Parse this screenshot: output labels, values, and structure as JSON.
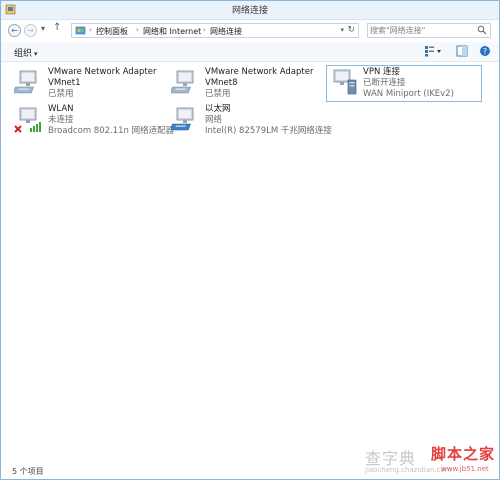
{
  "window": {
    "title": "网络连接"
  },
  "nav": {
    "back_glyph": "←",
    "forward_glyph": "→",
    "history_glyph": "▾",
    "up_glyph": "↑"
  },
  "address": {
    "crumbs": [
      "控制面板",
      "网络和 Internet",
      "网络连接"
    ],
    "separator": "›"
  },
  "search": {
    "placeholder": "搜索\"网络连接\""
  },
  "toolbar": {
    "organize_label": "组织",
    "organize_caret": "▾"
  },
  "connections": [
    {
      "name": "VMware Network Adapter",
      "line2": "VMnet1",
      "status": "已禁用",
      "icon": "network-adapter-icon"
    },
    {
      "name": "VMware Network Adapter",
      "line2": "VMnet8",
      "status": "已禁用",
      "icon": "network-adapter-icon"
    },
    {
      "name": "VPN 连接",
      "line2": "已断开连接",
      "status": "WAN Miniport (IKEv2)",
      "icon": "vpn-connection-icon"
    },
    {
      "name": "WLAN",
      "line2": "未连接",
      "status": "Broadcom 802.11n 网络适配器",
      "icon": "wireless-adapter-icon"
    },
    {
      "name": "以太网",
      "line2": "网络",
      "status": "Intel(R) 82579LM 千兆网络连接",
      "icon": "ethernet-adapter-icon"
    }
  ],
  "statusbar": {
    "item_count": "5 个项目"
  },
  "watermark": {
    "left_text": "查字典",
    "left_url": "jiaocheng.chazidian.com",
    "right_text": "脚本之家",
    "right_url": "www.jb51.net"
  },
  "colors": {
    "accent": "#2d7bd0",
    "disabled_x": "#d42020",
    "signal": "#3fa43f"
  }
}
